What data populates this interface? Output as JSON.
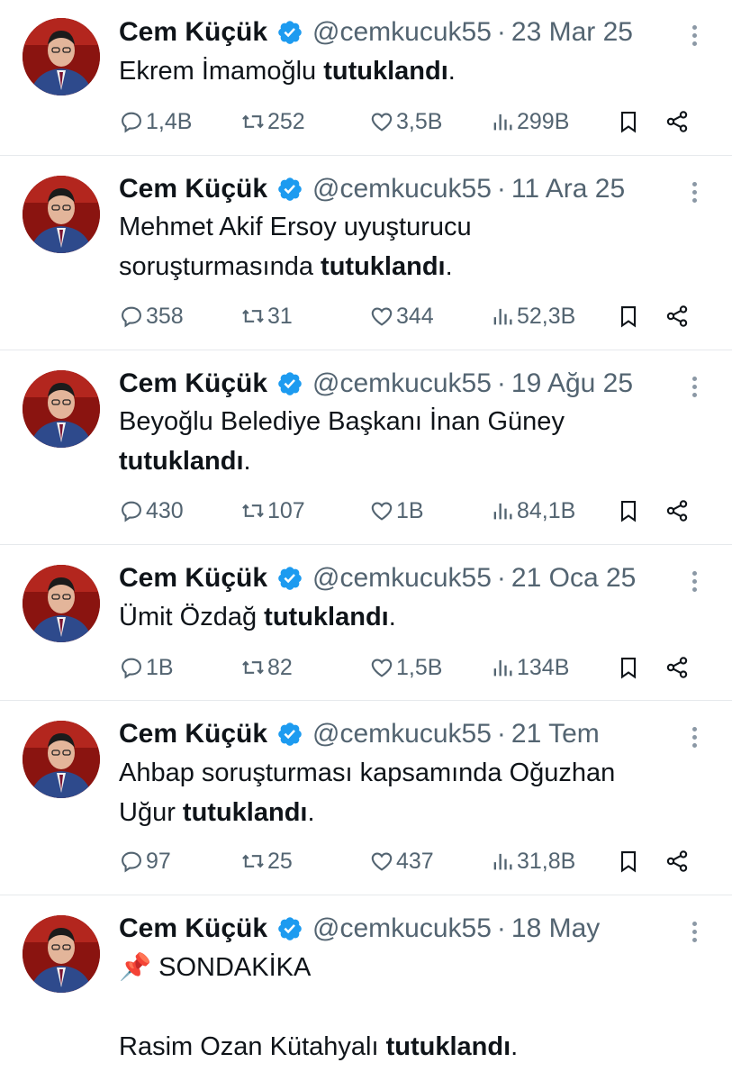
{
  "tweets": [
    {
      "name": "Cem Küçük",
      "handle": "@cemkucuk55",
      "date": "23 Mar 25",
      "text_plain": "Ekrem İmamoğlu ",
      "text_bold": "tutuklandı",
      "text_end": ".",
      "replies": "1,4B",
      "retweets": "252",
      "likes": "3,5B",
      "views": "299B"
    },
    {
      "name": "Cem Küçük",
      "handle": "@cemkucuk55",
      "date": "11 Ara 25",
      "text_plain": "Mehmet Akif Ersoy uyuşturucu\nsoruşturmasında ",
      "text_bold": "tutuklandı",
      "text_end": ".",
      "replies": "358",
      "retweets": "31",
      "likes": "344",
      "views": "52,3B"
    },
    {
      "name": "Cem Küçük",
      "handle": "@cemkucuk55",
      "date": "19 Ağu 25",
      "text_plain": "Beyoğlu Belediye Başkanı İnan Güney\n",
      "text_bold": "tutuklandı",
      "text_end": ".",
      "replies": "430",
      "retweets": "107",
      "likes": "1B",
      "views": "84,1B"
    },
    {
      "name": "Cem Küçük",
      "handle": "@cemkucuk55",
      "date": "21 Oca 25",
      "text_plain": "Ümit Özdağ ",
      "text_bold": "tutuklandı",
      "text_end": ".",
      "replies": "1B",
      "retweets": "82",
      "likes": "1,5B",
      "views": "134B"
    },
    {
      "name": "Cem Küçük",
      "handle": "@cemkucuk55",
      "date": "21 Tem",
      "text_plain": "Ahbap soruşturması kapsamında Oğuzhan\nUğur ",
      "text_bold": "tutuklandı",
      "text_end": ".",
      "replies": "97",
      "retweets": "25",
      "likes": "437",
      "views": "31,8B"
    },
    {
      "name": "Cem Küçük",
      "handle": "@cemkucuk55",
      "date": "18 May",
      "text_pin": "📌",
      "text_headline": "SONDAKİKA",
      "text_plain": "\n\nRasim Ozan Kütahyalı ",
      "text_bold": "tutuklandı",
      "text_end": "."
    }
  ],
  "colors": {
    "text": "#0f1419",
    "muted": "#536471",
    "verified": "#1d9bf0",
    "divider": "#e6e9ec"
  },
  "icons": [
    "reply-icon",
    "retweet-icon",
    "like-icon",
    "views-icon",
    "bookmark-icon",
    "share-icon",
    "verified-icon",
    "more-icon",
    "pin-icon"
  ]
}
